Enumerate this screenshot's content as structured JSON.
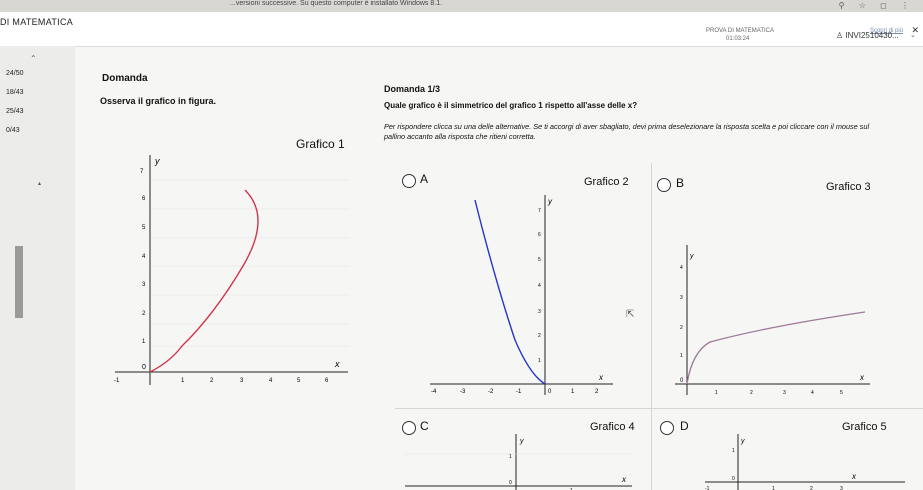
{
  "topbar": {
    "note": "...versioni successive. Su questo computer è installato Windows 8.1."
  },
  "app": {
    "title": "DI MATEMATICA",
    "fullscreen_label": "Scopri di più",
    "exam_name": "PROVA DI MATEMATICA",
    "timer": "01:03:24",
    "user_id": "INVI2510430..."
  },
  "sidebar": {
    "scores": [
      "24/50",
      "18/43",
      "25/43",
      "0/43"
    ]
  },
  "domanda": {
    "heading": "Domanda",
    "instruction": "Osserva il grafico in figura.",
    "graph_label": "Grafico 1"
  },
  "question": {
    "number": "Domanda 1/3",
    "text": "Quale grafico è il simmetrico del grafico 1 rispetto all'asse delle x?",
    "instructions": "Per rispondere clicca su una delle alternative. Se ti accorgi di aver sbagliato, devi prima deselezionare la risposta scelta e poi cliccare con il mouse sul pallino accanto alla risposta che ritieni corretta."
  },
  "options": [
    {
      "letter": "A",
      "graph_label": "Grafico 2"
    },
    {
      "letter": "B",
      "graph_label": "Grafico 3"
    },
    {
      "letter": "C",
      "graph_label": "Grafico 4"
    },
    {
      "letter": "D",
      "graph_label": "Grafico 5"
    }
  ],
  "axis_labels": {
    "x": "x",
    "y": "y",
    "origin": "0"
  },
  "graph1_ticks": {
    "x": [
      "-1",
      "1",
      "2",
      "3",
      "4",
      "5",
      "6"
    ],
    "y": [
      "1",
      "2",
      "3",
      "4",
      "5",
      "6",
      "7"
    ]
  },
  "graph2_ticks": {
    "x": [
      "-4",
      "-3",
      "-2",
      "-1",
      "1",
      "2"
    ],
    "y": [
      "1",
      "2",
      "3",
      "4",
      "5",
      "6",
      "7"
    ]
  },
  "graph3_ticks": {
    "x": [
      "1",
      "2",
      "3",
      "4",
      "5"
    ],
    "y": [
      "1",
      "2",
      "3",
      "4"
    ]
  },
  "graph4_ticks": {
    "x": [
      "1"
    ],
    "y": [
      "1"
    ]
  },
  "graph5_ticks": {
    "x": [
      "-1",
      "1",
      "2",
      "3"
    ],
    "y": [
      "1"
    ]
  },
  "colors": {
    "graph1_curve": "#d0364a",
    "graph2_curve": "#2436c8",
    "graph3_curve": "#a0789a"
  }
}
